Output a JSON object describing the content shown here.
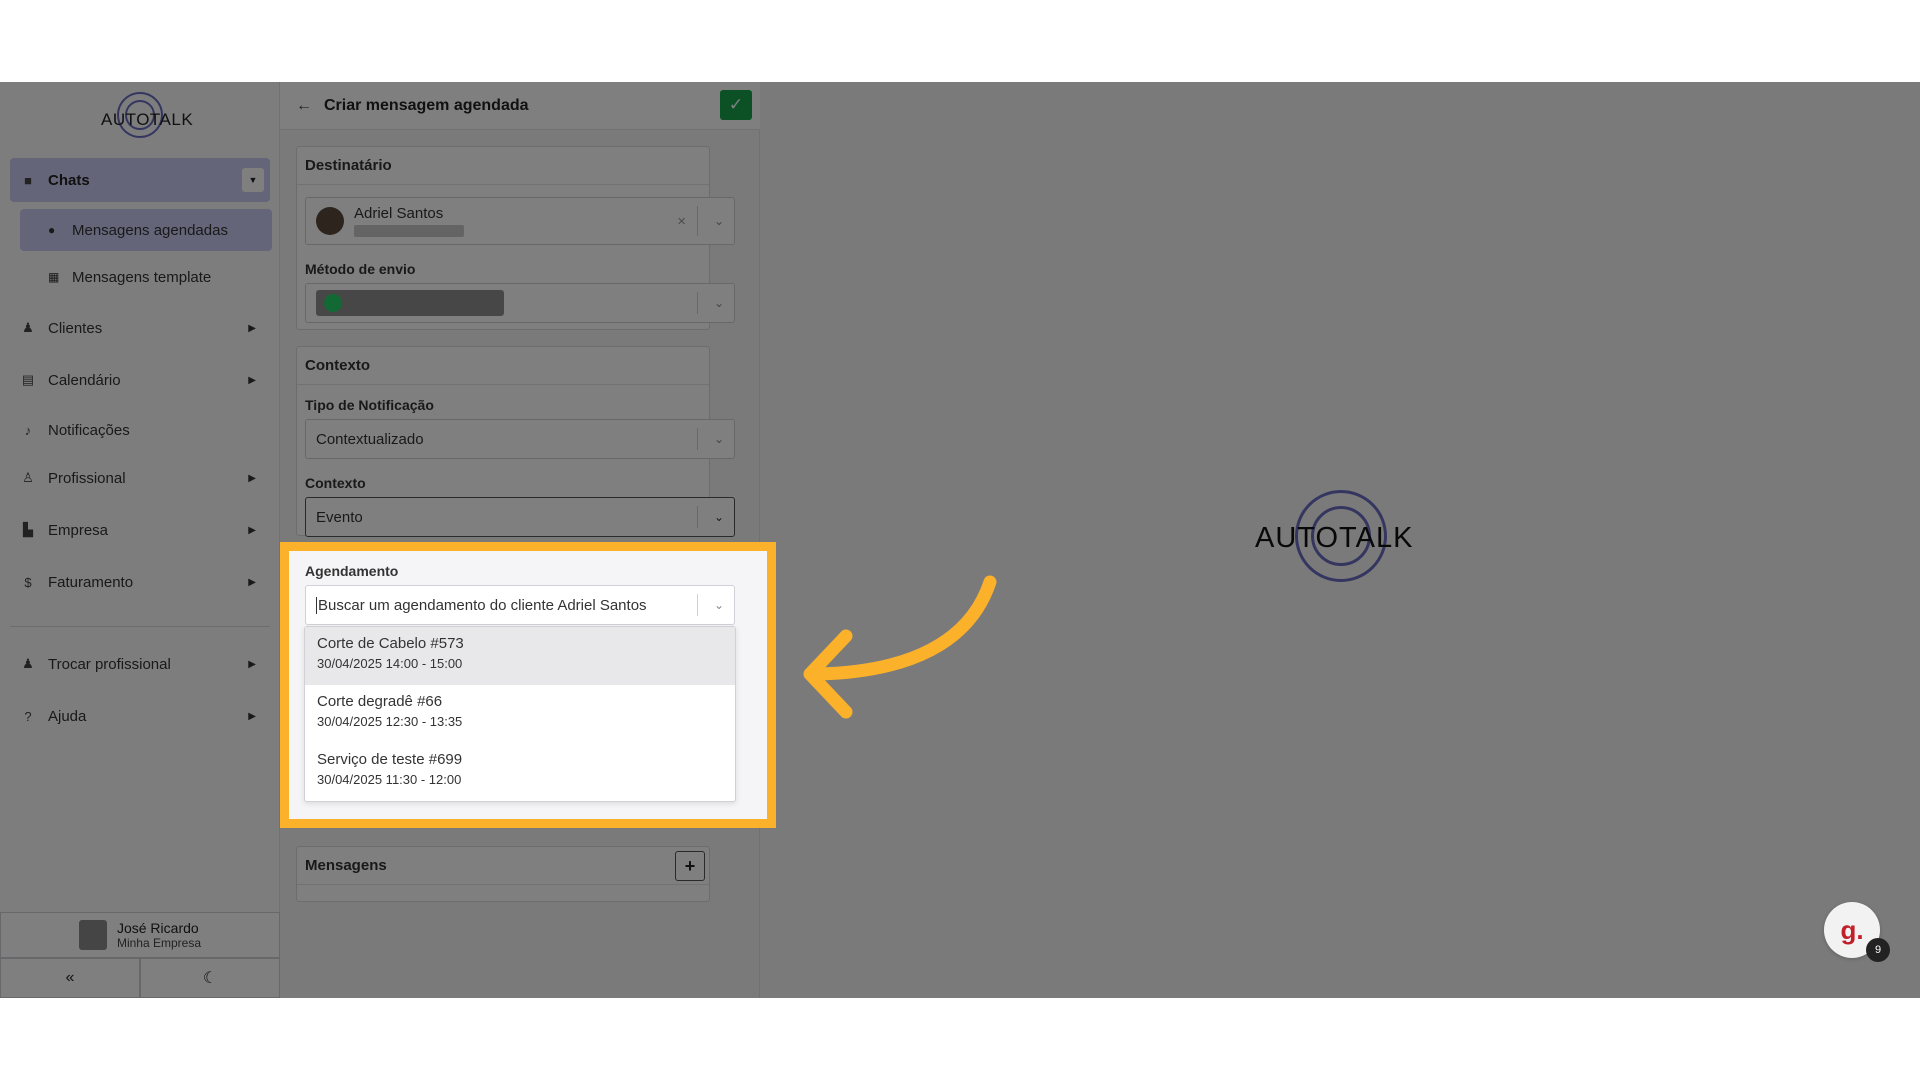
{
  "sidebar": {
    "logo_text": "AUTOTALK",
    "chats_label": "Chats",
    "sub_items": [
      "Mensagens agendadas",
      "Mensagens template"
    ],
    "items": [
      "Clientes",
      "Calendário",
      "Notificações",
      "Profissional",
      "Empresa",
      "Faturamento"
    ],
    "bottom_items": [
      "Trocar profissional",
      "Ajuda"
    ],
    "user_name": "José Ricardo",
    "user_company": "Minha Empresa",
    "collapse_icon": "«",
    "theme_icon": "☾"
  },
  "panel": {
    "back_icon": "←",
    "title": "Criar mensagem agendada",
    "confirm_icon": "✓",
    "destinatario_header": "Destinatário",
    "recipient_name": "Adriel Santos",
    "metodo_label": "Método de envio",
    "contexto_header": "Contexto",
    "tipo_label": "Tipo de Notificação",
    "tipo_value": "Contextualizado",
    "contexto_label": "Contexto",
    "contexto_value": "Evento",
    "agendamento_label": "Agendamento",
    "agendamento_placeholder": "Buscar um agendamento do cliente Adriel Santos",
    "mensagens_header": "Mensagens",
    "add_icon": "+",
    "clear_icon": "×",
    "chevron_icon": "⌄"
  },
  "options": [
    {
      "name": "Corte de Cabelo #573",
      "date": "30/04/2025 14:00 - 15:00"
    },
    {
      "name": "Corte degradê #66",
      "date": "30/04/2025 12:30 - 13:35"
    },
    {
      "name": "Serviço de teste #699",
      "date": "30/04/2025 11:30 - 12:00"
    }
  ],
  "center_logo": "AUTOTALK",
  "fab": {
    "label": "g.",
    "badge": "9"
  },
  "colors": {
    "accent": "#fbb12a",
    "confirm": "#17a34a",
    "nav_active": "#c9cbf3",
    "brand_ring": "#6a6cc0"
  }
}
